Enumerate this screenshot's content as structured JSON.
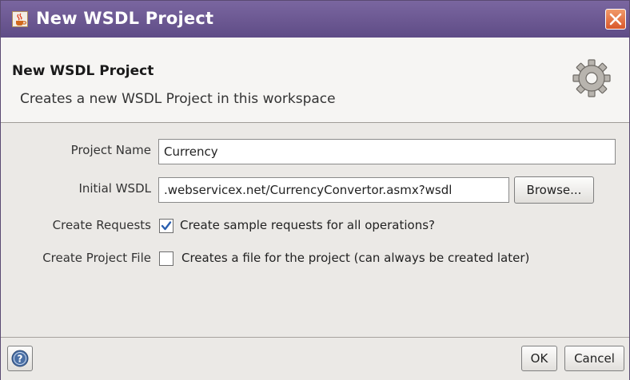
{
  "window": {
    "title": "New WSDL Project",
    "app_icon": "java-cup-icon",
    "close_icon": "close-icon"
  },
  "banner": {
    "title": "New WSDL Project",
    "description": "Creates a new WSDL Project in this workspace",
    "icon": "gear-icon"
  },
  "form": {
    "project_name": {
      "label": "Project Name",
      "value": "Currency"
    },
    "initial_wsdl": {
      "label": "Initial WSDL",
      "value": ".webservicex.net/CurrencyConvertor.asmx?wsdl",
      "browse_label": "Browse..."
    },
    "create_requests": {
      "label": "Create Requests",
      "checked": true,
      "text": "Create sample requests for all operations?"
    },
    "create_project_file": {
      "label": "Create Project File",
      "checked": false,
      "text": "Creates a file for the project (can always be created later)"
    }
  },
  "footer": {
    "help_icon": "help-icon",
    "ok_label": "OK",
    "cancel_label": "Cancel"
  },
  "colors": {
    "titlebar": "#6a5792",
    "close_button": "#e06a3a",
    "checkbox_check": "#2a5fb0"
  }
}
